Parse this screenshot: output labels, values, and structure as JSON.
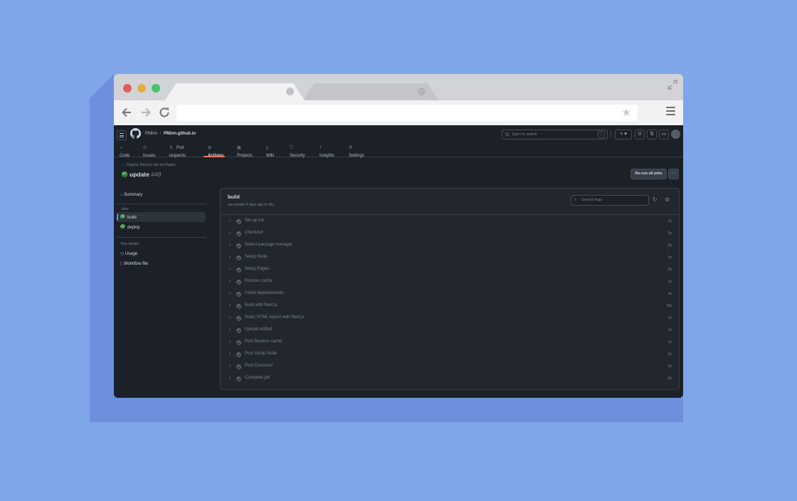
{
  "browser": {
    "traffic_lights": [
      "#e25c5c",
      "#e0b13a",
      "#3fc56a"
    ],
    "address": ""
  },
  "github": {
    "owner": "PMinn",
    "repo": "PMinn.github.io",
    "search_placeholder": "Type / to search",
    "tabs": [
      {
        "icon": "code-icon",
        "label": "Code"
      },
      {
        "icon": "issue-icon",
        "label": "Issues"
      },
      {
        "icon": "pull-request-icon",
        "label": "Pull requests"
      },
      {
        "icon": "actions-icon",
        "label": "Actions"
      },
      {
        "icon": "projects-icon",
        "label": "Projects"
      },
      {
        "icon": "wiki-icon",
        "label": "Wiki"
      },
      {
        "icon": "security-icon",
        "label": "Security"
      },
      {
        "icon": "insights-icon",
        "label": "Insights"
      },
      {
        "icon": "settings-icon",
        "label": "Settings"
      }
    ],
    "active_tab": "Actions",
    "accent": "#ec775c"
  },
  "run": {
    "breadcrumb": "Deploy Next.js site to Pages",
    "title": "update",
    "number": "#49",
    "rerun_label": "Re-run all jobs",
    "more_label": "···",
    "success_color": "#57ab5a"
  },
  "sidebar": {
    "summary": "Summary",
    "jobs_heading": "Jobs",
    "jobs": [
      "build",
      "deploy"
    ],
    "run_details_heading": "Run details",
    "usage": "Usage",
    "workflow_file": "Workflow file"
  },
  "job": {
    "name": "build",
    "status": "succeeded 3 days ago in 26s",
    "search_placeholder": "Search logs",
    "steps": [
      {
        "label": "Set up job",
        "duration": "1s"
      },
      {
        "label": "Checkout",
        "duration": "2s"
      },
      {
        "label": "Detect package manager",
        "duration": "0s"
      },
      {
        "label": "Setup Node",
        "duration": "5s"
      },
      {
        "label": "Setup Pages",
        "duration": "0s"
      },
      {
        "label": "Restore cache",
        "duration": "1s"
      },
      {
        "label": "Install dependencies",
        "duration": "4s"
      },
      {
        "label": "Build with Next.js",
        "duration": "18s"
      },
      {
        "label": "Static HTML export with Next.js",
        "duration": "1s"
      },
      {
        "label": "Upload artifact",
        "duration": "1s"
      },
      {
        "label": "Post Restore cache",
        "duration": "1s"
      },
      {
        "label": "Post Setup Node",
        "duration": "0s"
      },
      {
        "label": "Post Checkout",
        "duration": "0s"
      },
      {
        "label": "Complete job",
        "duration": "0s"
      }
    ]
  }
}
